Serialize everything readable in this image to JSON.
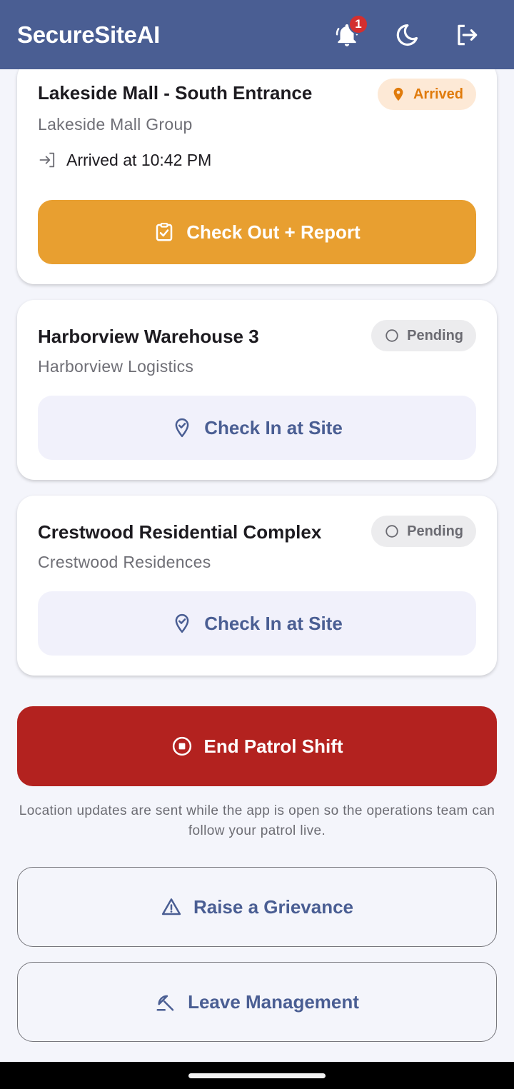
{
  "app": {
    "title": "SecureSiteAI",
    "notification_count": "1",
    "icons": [
      "bell-icon",
      "moon-icon",
      "logout-icon"
    ]
  },
  "sites": [
    {
      "name": "Lakeside Mall - South Entrance",
      "client": "Lakeside Mall Group",
      "status": "Arrived",
      "arrived_text": "Arrived at 10:42 PM",
      "action_label": "Check Out + Report"
    },
    {
      "name": "Harborview Warehouse 3",
      "client": "Harborview Logistics",
      "status": "Pending",
      "action_label": "Check In at Site"
    },
    {
      "name": "Crestwood Residential Complex",
      "client": "Crestwood Residences",
      "status": "Pending",
      "action_label": "Check In at Site"
    }
  ],
  "shift": {
    "end_label": "End Patrol Shift",
    "note": "Location updates are sent while the app is open so the operations team can follow your patrol live."
  },
  "links": {
    "grievance_label": "Raise a Grievance",
    "leave_label": "Leave Management"
  },
  "colors": {
    "appbar": "#4a5e93",
    "arrived": "#e07b0c",
    "checkout_button": "#e89f30",
    "end_shift": "#b3221f",
    "accent_text": "#4a5e93"
  }
}
